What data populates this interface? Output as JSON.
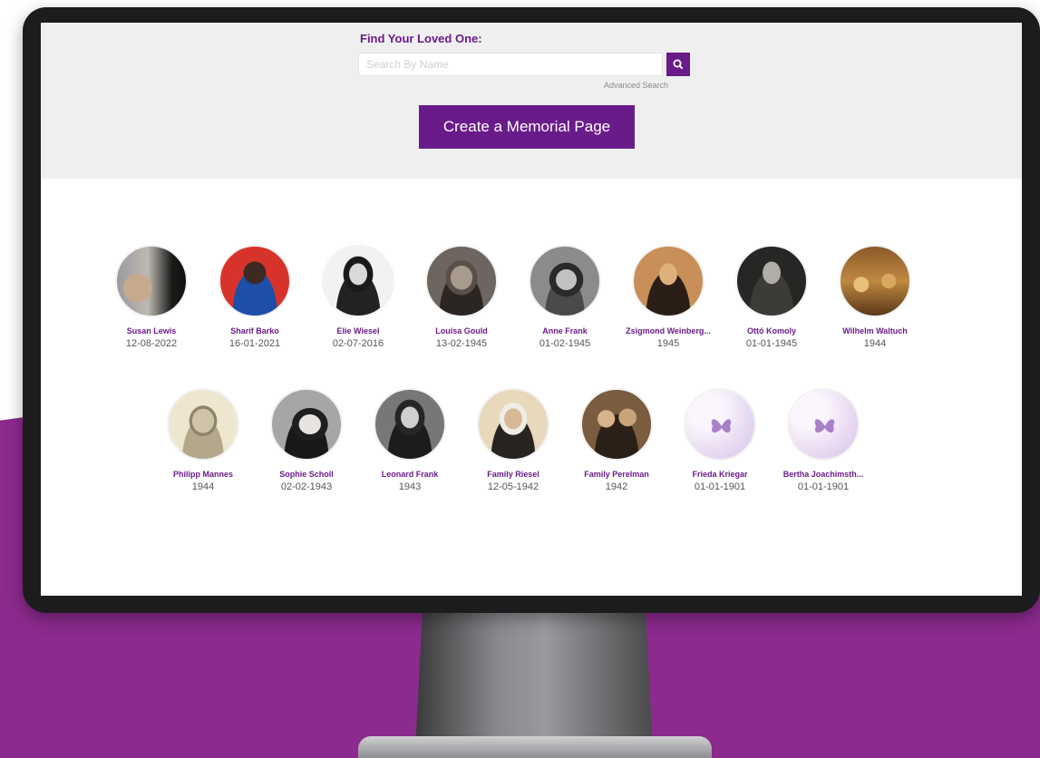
{
  "search": {
    "label": "Find Your Loved One:",
    "placeholder": "Search By Name",
    "value": "",
    "advanced_label": "Advanced Search"
  },
  "create_button_label": "Create a Memorial Page",
  "colors": {
    "brand_purple": "#6a1b8a",
    "background_purple": "#8c2a8e",
    "accent_orange": "#f0a020"
  },
  "memorials_row1": [
    {
      "name": "Susan Lewis",
      "date": "12-08-2022"
    },
    {
      "name": "Sharif Barko",
      "date": "16-01-2021"
    },
    {
      "name": "Elie Wiesel",
      "date": "02-07-2016"
    },
    {
      "name": "Louisa Gould",
      "date": "13-02-1945"
    },
    {
      "name": "Anne Frank",
      "date": "01-02-1945"
    },
    {
      "name": "Zsigmond Weinberg...",
      "date": "1945"
    },
    {
      "name": "Ottó Komoly",
      "date": "01-01-1945"
    },
    {
      "name": "Wilhelm Waltuch",
      "date": "1944"
    }
  ],
  "memorials_row2": [
    {
      "name": "Philipp Mannes",
      "date": "1944"
    },
    {
      "name": "Sophie Scholl",
      "date": "02-02-1943"
    },
    {
      "name": "Leonard Frank",
      "date": "1943"
    },
    {
      "name": "Family Riesel",
      "date": "12-05-1942"
    },
    {
      "name": "Family Perelman",
      "date": "1942"
    },
    {
      "name": "Frieda Kriegar",
      "date": "01-01-1901"
    },
    {
      "name": "Bertha Joachimsth...",
      "date": "01-01-1901"
    }
  ]
}
